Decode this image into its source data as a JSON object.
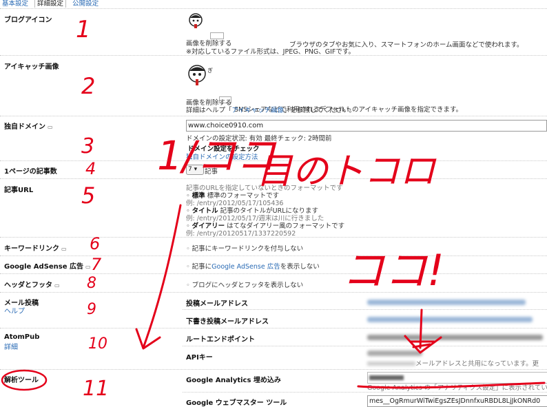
{
  "tabs": [
    {
      "label": "基本設定",
      "active": false
    },
    {
      "label": "詳細設定",
      "active": true
    },
    {
      "label": "公開設定",
      "active": false
    }
  ],
  "blog_icon": {
    "label": "ブログアイコン",
    "desc1": "ブラウザのタブやお気に入り、スマートフォンのホーム画面などで使われます。",
    "desc2": "※対応しているファイル形式は、JPEG、PNG、GIFです。",
    "remove": "画像を削除する"
  },
  "eyecatch": {
    "label": "アイキャッチ画像",
    "desc1": "SNSシェアなどで利用されるデフォルトのアイキャッチ画像を指定できます。",
    "desc2_pre": "詳細はヘルプ「",
    "desc2_link": "アイキャッチ画像",
    "desc2_post": "」を参照してください。",
    "remove": "画像を削除する"
  },
  "domain": {
    "label": "独自ドメイン",
    "value": "www.choice0910.com",
    "status": "ドメインの設定状況: 有効  最終チェック: 2時間前",
    "check": "ドメイン設定をチェック",
    "help_link": "独自ドメインの設定方法"
  },
  "per_page": {
    "label": "1ページの記事数",
    "value": "7",
    "unit": "記事"
  },
  "article_url": {
    "label": "記事URL",
    "intro": "記事のURLを指定していないときのフォーマットです",
    "options": [
      {
        "name": "標準",
        "desc": "標準のフォーマットです",
        "example": "例: /entry/2012/05/17/105436"
      },
      {
        "name": "タイトル",
        "desc": "記事のタイトルがURLになります",
        "example": "例: /entry/2012/05/17/週末は川に行きました"
      },
      {
        "name": "ダイアリー",
        "desc": "はてなダイアリー風のフォーマットです",
        "example": "例: /entry/20120517/1337220592"
      }
    ]
  },
  "keyword": {
    "label": "キーワードリンク",
    "text": "記事にキーワードリンクを付与しない"
  },
  "adsense": {
    "label": "Google AdSense 広告",
    "pre": "記事に",
    "link": "Google AdSense 広告",
    "post": "を表示しない"
  },
  "header_footer": {
    "label": "ヘッダとフッタ",
    "text": "ブログにヘッダとフッタを表示しない"
  },
  "mail": {
    "label": "メール投稿",
    "help": "ヘルプ",
    "post_addr": "投稿メールアドレス",
    "draft_addr": "下書き投稿メールアドレス"
  },
  "atompub": {
    "label": "AtomPub",
    "help": "詳細",
    "endpoint": "ルートエンドポイント",
    "apikey": "APIキー",
    "apikey_note": "メールアドレスと共用になっています。更"
  },
  "analytics": {
    "label": "解析ツール",
    "ga": "Google Analytics 埋め込み",
    "ga_note": "Google Analytics の「アナリティクス設定」に表示されてい",
    "wmt": "Google ウェブマスター ツール",
    "wmt_value": "mes__OgRmurWiTwiEgsZEsJDnnfxuRBDL8LjJkONRd0"
  },
  "annotations": {
    "n1": "1",
    "n2": "2",
    "n3": "3",
    "n4": "4",
    "n5": "5",
    "n6": "6",
    "n7": "7",
    "n8": "8",
    "n9": "9",
    "n10": "10",
    "n11": "11",
    "big1": "1/ココ",
    "big2": "目のトコロ",
    "big3": "ココ!"
  },
  "colors": {
    "link": "#2a6bb5",
    "annotation": "#e4001a"
  }
}
